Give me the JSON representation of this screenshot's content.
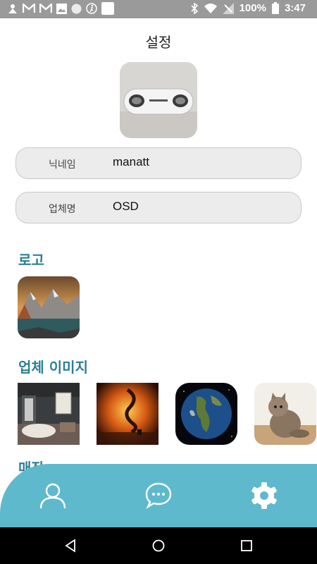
{
  "status_bar": {
    "battery": "100%",
    "time": "3:47"
  },
  "header": {
    "title": "설정"
  },
  "profile": {
    "nickname_label": "닉네임",
    "nickname_value": "manatt",
    "company_label": "업체명",
    "company_value": "OSD"
  },
  "sections": {
    "logo_title": "로고",
    "company_images_title": "업체 이미지",
    "partial_title": "매장"
  },
  "bottom_nav": {
    "items": [
      {
        "icon": "user-icon"
      },
      {
        "icon": "chat-icon"
      },
      {
        "icon": "gear-icon"
      }
    ]
  },
  "colors": {
    "accent": "#2b7f95",
    "nav_bg": "#5fb9cd",
    "field_bg": "#ececec",
    "status_bg": "#9a9a9a"
  }
}
